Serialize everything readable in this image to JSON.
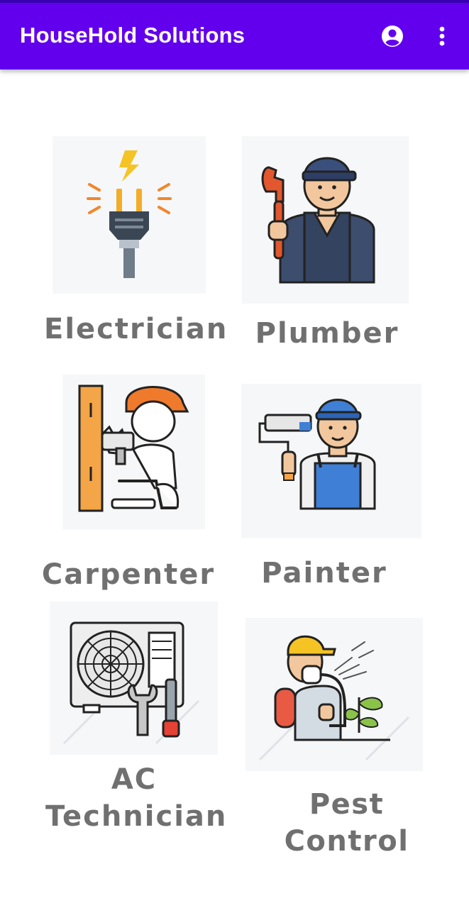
{
  "app_bar": {
    "title": "HouseHold Solutions",
    "account_icon": "account-circle-icon",
    "menu_icon": "more-vert-icon",
    "color": "#6200ee",
    "status_color": "#3700b3"
  },
  "services": [
    {
      "label": "Electrician",
      "icon": "electric-plug-icon"
    },
    {
      "label": "Plumber",
      "icon": "plumber-with-wrench-icon"
    },
    {
      "label": "Carpenter",
      "icon": "carpenter-drilling-icon"
    },
    {
      "label": "Painter",
      "icon": "painter-with-roller-icon"
    },
    {
      "label_line1": "AC",
      "label_line2": "Technician",
      "icon": "ac-unit-with-tools-icon"
    },
    {
      "label": "Pest Control",
      "icon": "pest-control-sprayer-icon"
    }
  ]
}
